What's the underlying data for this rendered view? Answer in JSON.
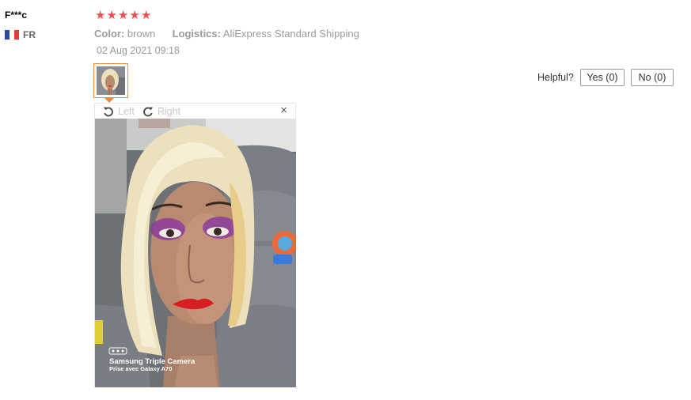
{
  "review": {
    "user_name": "F***c",
    "country_code": "FR",
    "rating": 5,
    "color_label": "Color:",
    "color_value": "brown",
    "logistics_label": "Logistics:",
    "logistics_value": "AliExpress Standard Shipping",
    "date": "02 Aug 2021 09:18"
  },
  "helpful": {
    "label": "Helpful?",
    "yes_label": "Yes (0)",
    "no_label": "No (0)"
  },
  "viewer": {
    "rotate_left_label": "Left",
    "rotate_right_label": "Right",
    "close_glyph": "×",
    "photo_watermark_line1": "Samsung Triple Camera",
    "photo_watermark_line2": "Prise avec Galaxy A70"
  },
  "colors": {
    "star": "#f44c4c",
    "thumb_border": "#e98b3a",
    "flag_blue": "#2a48a8",
    "flag_white": "#ffffff",
    "flag_red": "#e53a3a"
  },
  "icons": {
    "rating": "star-icon",
    "rotate_left": "rotate-left-icon",
    "rotate_right": "rotate-right-icon",
    "close": "close-icon",
    "flag": "france-flag-icon"
  }
}
